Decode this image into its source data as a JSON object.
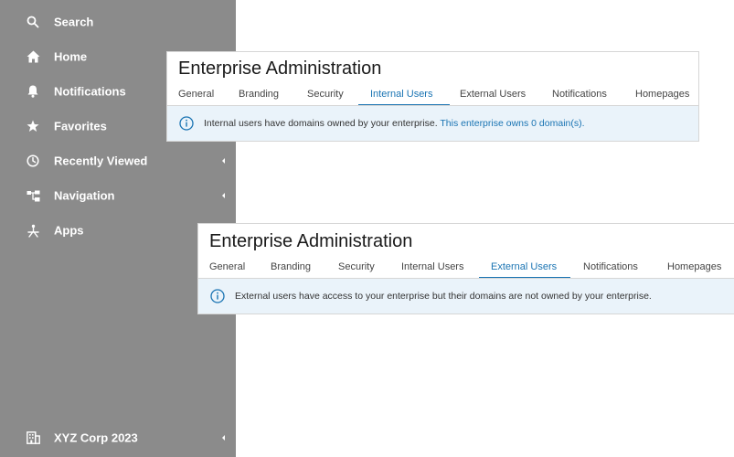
{
  "sidebar": {
    "items": [
      {
        "label": "Search",
        "icon": "search-icon",
        "expandable": false
      },
      {
        "label": "Home",
        "icon": "home-icon",
        "expandable": false
      },
      {
        "label": "Notifications",
        "icon": "bell-icon",
        "expandable": false
      },
      {
        "label": "Favorites",
        "icon": "star-icon",
        "expandable": false
      },
      {
        "label": "Recently Viewed",
        "icon": "clock-icon",
        "expandable": true
      },
      {
        "label": "Navigation",
        "icon": "navigation-tree-icon",
        "expandable": true
      },
      {
        "label": "Apps",
        "icon": "apps-icon",
        "expandable": false
      }
    ],
    "footer": {
      "label": "XYZ Corp 2023",
      "icon": "building-icon",
      "expandable": true
    }
  },
  "panels": [
    {
      "title": "Enterprise Administration",
      "tabs": [
        {
          "label": "General"
        },
        {
          "label": "Branding"
        },
        {
          "label": "Security"
        },
        {
          "label": "Internal Users"
        },
        {
          "label": "External Users"
        },
        {
          "label": "Notifications"
        },
        {
          "label": "Homepages"
        }
      ],
      "active_tab": "Internal Users",
      "info": {
        "icon": "info-icon",
        "text": "Internal users have domains owned by your enterprise.",
        "link_text": "This enterprise owns 0 domain(s)."
      }
    },
    {
      "title": "Enterprise Administration",
      "tabs": [
        {
          "label": "General"
        },
        {
          "label": "Branding"
        },
        {
          "label": "Security"
        },
        {
          "label": "Internal Users"
        },
        {
          "label": "External Users"
        },
        {
          "label": "Notifications"
        },
        {
          "label": "Homepages"
        }
      ],
      "active_tab": "External Users",
      "info": {
        "icon": "info-icon",
        "text": "External users have access to your enterprise but their domains are not owned by your enterprise.",
        "link_text": ""
      }
    }
  ],
  "colors": {
    "sidebar_bg": "#8b8b8b",
    "accent": "#1a74b3",
    "info_bg": "#eaf3fa"
  }
}
